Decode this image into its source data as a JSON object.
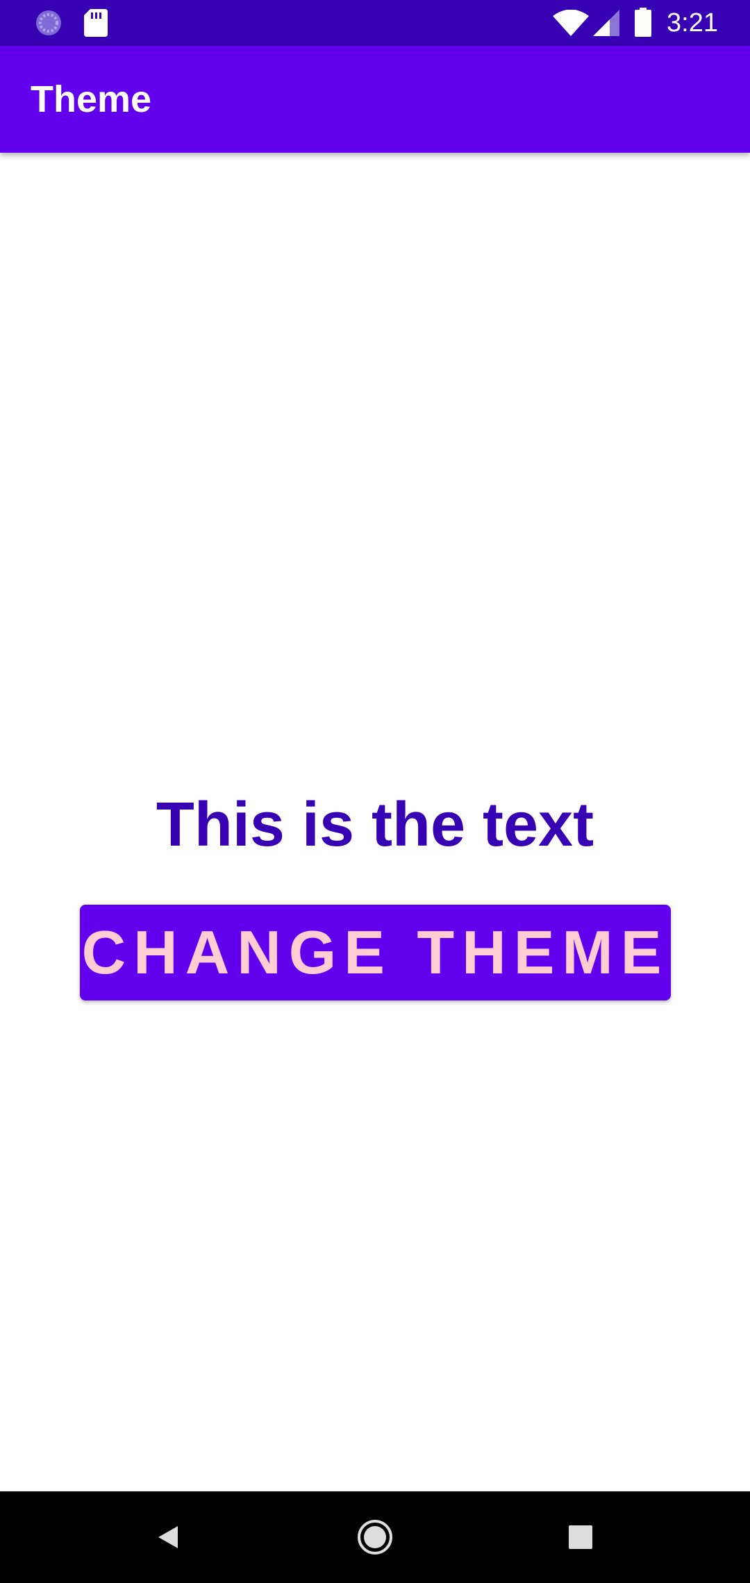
{
  "status_bar": {
    "time": "3:21",
    "left_icons": [
      "loading-spinner-icon",
      "sd-card-icon"
    ],
    "right_icons": [
      "wifi-icon",
      "cell-signal-icon",
      "battery-icon"
    ],
    "background_color": "#3700B3"
  },
  "app_bar": {
    "title": "Theme",
    "background_color": "#6200EE"
  },
  "main": {
    "text": "This is the text",
    "text_color": "#3700B3",
    "change_theme_button": {
      "label": "CHANGE THEME",
      "background_color": "#6200EE",
      "text_color": "#FFCDD2"
    }
  },
  "nav_bar": {
    "buttons": [
      "back-icon",
      "home-icon",
      "recents-icon"
    ],
    "background_color": "#000000"
  }
}
